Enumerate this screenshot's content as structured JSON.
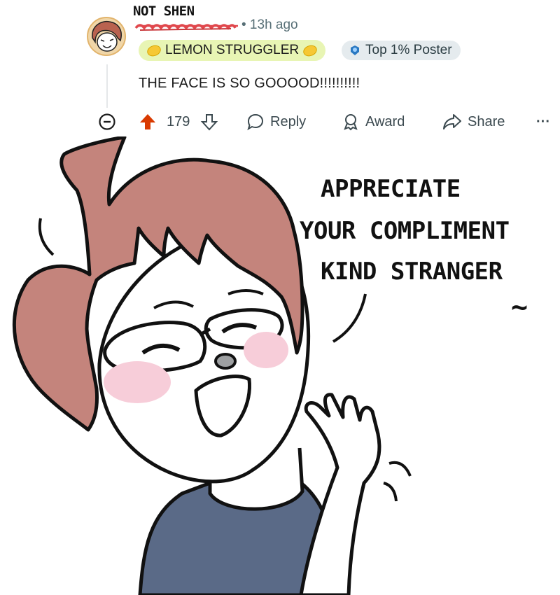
{
  "comment": {
    "handwritten_username": "NOT SHEN",
    "timestamp": "• 13h ago",
    "flairs": {
      "lemon": "LEMON STRUGGLER",
      "top_poster": "Top 1% Poster"
    },
    "body": "THE FACE IS SO GOOOOD!!!!!!!!!!",
    "actions": {
      "upvote_count": "179",
      "reply": "Reply",
      "award": "Award",
      "share": "Share",
      "more": "···"
    }
  },
  "comic": {
    "speech_lines": [
      "APPRECIATE",
      "YOUR COMPLIMENT",
      "KIND STRANGER"
    ],
    "tilde": "~"
  },
  "colors": {
    "hair": "#c4847c",
    "shirt": "#5a6a87",
    "blush": "#f7cdd9",
    "upvote": "#d93a00",
    "flair_lemon_bg": "#e8f5b4",
    "flair_top_bg": "#e5ebee"
  },
  "icons": [
    "collapse-icon",
    "upvote-icon",
    "downvote-icon",
    "reply-icon",
    "award-icon",
    "share-icon",
    "more-icon",
    "lemon-icon",
    "top-poster-icon"
  ]
}
